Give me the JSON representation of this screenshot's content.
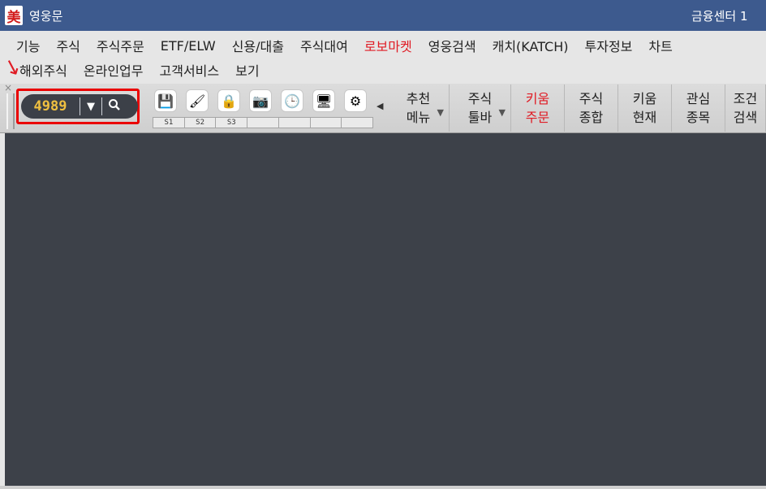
{
  "title_bar": {
    "logo_text": "美",
    "app_title": "영웅문",
    "right_text": "금융센터 1"
  },
  "menu": {
    "row1": [
      "기능",
      "주식",
      "주식주문",
      "ETF/ELW",
      "신용/대출",
      "주식대여",
      "로보마켓",
      "영웅검색",
      "캐치(KATCH)",
      "투자정보",
      "차트"
    ],
    "row2": [
      "해외주식",
      "온라인업무",
      "고객서비스",
      "보기"
    ],
    "highlight": "로보마켓",
    "highlight_color": "#e01b24"
  },
  "stock_selector": {
    "code": "4989",
    "dropdown_icon": "chevron-down-icon",
    "search_icon": "search-icon"
  },
  "quick_icons": [
    {
      "name": "save-icon",
      "glyph": "💾"
    },
    {
      "name": "brush-icon",
      "glyph": "🖌"
    },
    {
      "name": "lock-icon",
      "glyph": "🔒"
    },
    {
      "name": "camera-icon",
      "glyph": "📷"
    },
    {
      "name": "clock-icon",
      "glyph": "🕒"
    },
    {
      "name": "monitor-icon",
      "glyph": "🖥"
    },
    {
      "name": "gear-icon",
      "glyph": "⚙"
    }
  ],
  "slots": [
    "S1",
    "S2",
    "S3",
    "",
    "",
    "",
    ""
  ],
  "toolbar_buttons": [
    {
      "line1": "추천",
      "line2": "메뉴",
      "dropdown": true,
      "red": false
    },
    {
      "line1": "주식",
      "line2": "툴바",
      "dropdown": true,
      "red": false
    },
    {
      "line1": "키움",
      "line2": "주문",
      "dropdown": false,
      "red": true
    },
    {
      "line1": "주식",
      "line2": "종합",
      "dropdown": false,
      "red": false
    },
    {
      "line1": "키움",
      "line2": "현재",
      "dropdown": false,
      "red": false
    },
    {
      "line1": "관심",
      "line2": "종목",
      "dropdown": false,
      "red": false
    },
    {
      "line1": "조건",
      "line2": "검색",
      "dropdown": false,
      "red": false
    }
  ],
  "colors": {
    "title_bar": "#3d5a8e",
    "main_area": "#3d4149",
    "stock_code": "#f0c040",
    "highlight_box": "#ea0000"
  }
}
